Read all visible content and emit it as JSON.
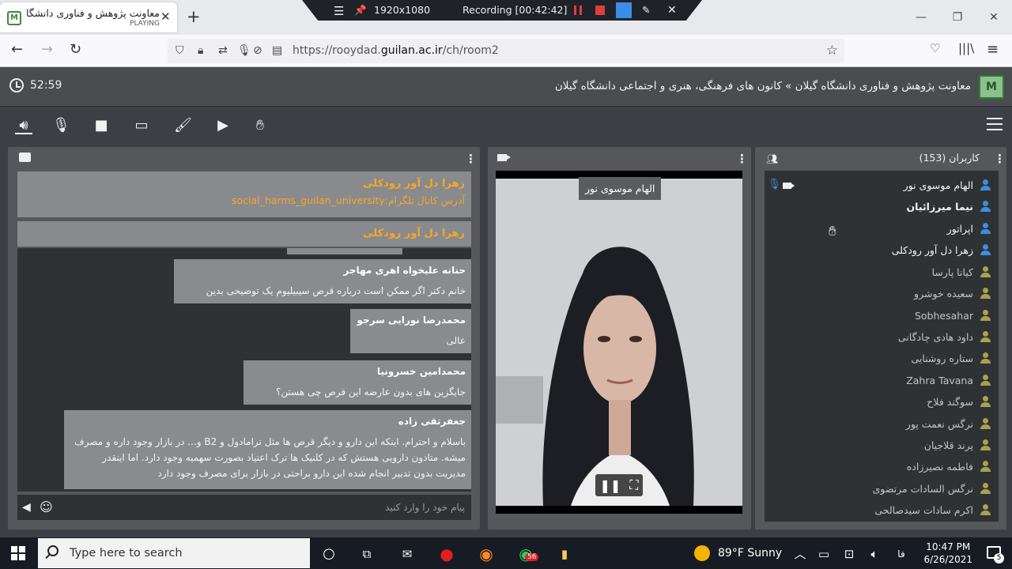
{
  "browser": {
    "tab_title": "معاونت پژوهش و فناوری دانشگاه",
    "tab_status": "PLAYING",
    "url_prefix": "https://rooydad.",
    "url_domain": "guilan.ac.ir",
    "url_path": "/ch/room2"
  },
  "recording": {
    "resolution": "1920x1080",
    "status": "Recording [00:42:42]"
  },
  "header": {
    "timer": "52:59",
    "title": "معاونت پژوهش و فناوری دانشگاه گیلان » کانون های فرهنگی، هنری و اجتماعی دانشگاه گیلان"
  },
  "chat": {
    "pinned": [
      {
        "name": "زهرا دل آور رودکلی",
        "text": "آدرس کانال تلگرام:social_harms_guilan_university"
      },
      {
        "name": "زهرا دل آور رودکلی"
      }
    ],
    "messages": [
      {
        "name": "حنانه علیخواه اهری مهاجر",
        "text": "خانم دکتر اگر ممکن است درباره قرص سیبیلیوم یک توضیحی بدین"
      },
      {
        "name": "محمدرضا نورایی سرجو",
        "text": "عالی"
      },
      {
        "name": "محمدامین خسرونیا",
        "text": "جایگزین های بدون عارضه این قرص چی هستن؟"
      },
      {
        "name": "جعفرتقی زاده",
        "text": "باسلام و احترام. اینکه این دارو و دیگر قرص ها مثل ترامادول و B2 و...    در بازار وجود داره و مصرف میشه. متادون دارویی هستش که در کلنیک ها ترک اعتیاد بصورت سهمیه وجود دارد. اما اینقدر مدیریت بدون تدبیر انجام شده این دارو براحتی در بازار برای مصرف وجود دارد"
      }
    ],
    "input_placeholder": "پیام خود را وارد کنید"
  },
  "video": {
    "speaker_name": "الهام موسوی نور"
  },
  "users": {
    "title": "کاربران (153)",
    "list": [
      {
        "name": "الهام موسوی نور",
        "role": "mod"
      },
      {
        "name": "نیما میرزائیان",
        "role": "mod"
      },
      {
        "name": "اپراتور",
        "role": "mod"
      },
      {
        "name": "زهرا دل آور رودکلی",
        "role": "mod"
      },
      {
        "name": "کیانا پارسا",
        "role": "view"
      },
      {
        "name": "سعیده خوشرو",
        "role": "view"
      },
      {
        "name": "Sobhesahar",
        "role": "view"
      },
      {
        "name": "داود هادی چادگانی",
        "role": "view"
      },
      {
        "name": "ستاره روشنایی",
        "role": "view"
      },
      {
        "name": "Zahra Tavana",
        "role": "view"
      },
      {
        "name": "سوگند فلاح",
        "role": "view"
      },
      {
        "name": "نرگس نعمت پور",
        "role": "view"
      },
      {
        "name": "پرند قلاجیان",
        "role": "view"
      },
      {
        "name": "فاطمه نصیرزاده",
        "role": "view"
      },
      {
        "name": "نرگس السادات مرتضوی",
        "role": "view"
      },
      {
        "name": "اکرم سادات سیدصالحی",
        "role": "view"
      }
    ]
  },
  "taskbar": {
    "search_placeholder": "Type here to search",
    "weather": "89°F  Sunny",
    "lang": "فا",
    "time": "10:47 PM",
    "date": "6/26/2021",
    "whatsapp_badge": "56",
    "notif_badge": "5"
  },
  "colors": {
    "accent_orange": "#f7a823",
    "moderator_blue": "#3d8ede",
    "viewer_olive": "#a8a24e"
  }
}
